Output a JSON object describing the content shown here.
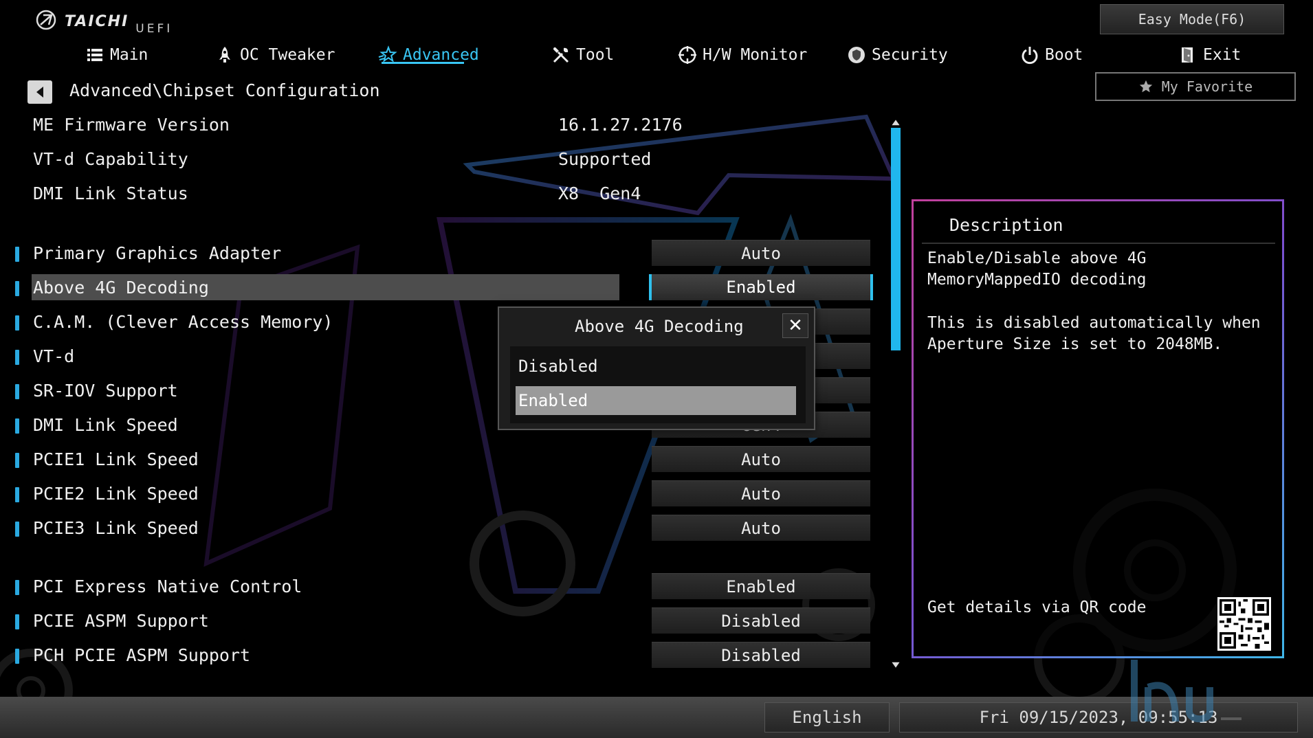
{
  "brand": {
    "name": "TAICHI",
    "sub": "UEFI"
  },
  "header": {
    "easy_mode": "Easy Mode(F6)",
    "my_favorite": "My Favorite"
  },
  "nav": [
    {
      "label": "Main",
      "icon": "list-icon"
    },
    {
      "label": "OC Tweaker",
      "icon": "rocket-icon"
    },
    {
      "label": "Advanced",
      "icon": "star-icon",
      "active": true
    },
    {
      "label": "Tool",
      "icon": "tools-icon"
    },
    {
      "label": "H/W Monitor",
      "icon": "crosshair-icon"
    },
    {
      "label": "Security",
      "icon": "shield-icon"
    },
    {
      "label": "Boot",
      "icon": "power-icon"
    },
    {
      "label": "Exit",
      "icon": "exit-door-icon"
    }
  ],
  "breadcrumb": "Advanced\\Chipset Configuration",
  "info": [
    {
      "label": "ME Firmware Version",
      "value": "16.1.27.2176"
    },
    {
      "label": "VT-d Capability",
      "value": "Supported"
    },
    {
      "label": "DMI Link Status",
      "value": "X8  Gen4"
    }
  ],
  "settings": [
    {
      "label": "Primary Graphics Adapter",
      "value": "Auto"
    },
    {
      "label": "Above 4G Decoding",
      "value": "Enabled",
      "selected": true
    },
    {
      "label": "C.A.M. (Clever Access Memory)",
      "value": "Enabled"
    },
    {
      "label": "VT-d",
      "value": ""
    },
    {
      "label": "SR-IOV Support",
      "value": ""
    },
    {
      "label": "DMI Link Speed",
      "value": "Gen4"
    },
    {
      "label": "PCIE1 Link Speed",
      "value": "Auto"
    },
    {
      "label": "PCIE2 Link Speed",
      "value": "Auto"
    },
    {
      "label": "PCIE3 Link Speed",
      "value": "Auto"
    },
    {
      "label": "PCI Express Native Control",
      "value": "Enabled"
    },
    {
      "label": "PCIE ASPM Support",
      "value": "Disabled"
    },
    {
      "label": "PCH PCIE ASPM Support",
      "value": "Disabled"
    }
  ],
  "popup": {
    "title": "Above 4G Decoding",
    "close": "✕",
    "options": [
      "Disabled",
      "Enabled"
    ],
    "selected": "Enabled"
  },
  "description": {
    "title": "Description",
    "lines": [
      "Enable/Disable above 4G",
      "MemoryMappedIO decoding",
      "",
      "This is disabled automatically when",
      "Aperture Size is set to 2048MB."
    ],
    "qr_label": "Get details via QR code"
  },
  "footer": {
    "language": "English",
    "datetime": "Fri 09/15/2023, 09:55:13"
  },
  "colors": {
    "accent": "#39c6f4",
    "marker": "#2aa9e0",
    "selected_row": "#4d4d4d",
    "panel_border_pink": "#c2409c",
    "panel_border_blue": "#3fb6e8"
  }
}
